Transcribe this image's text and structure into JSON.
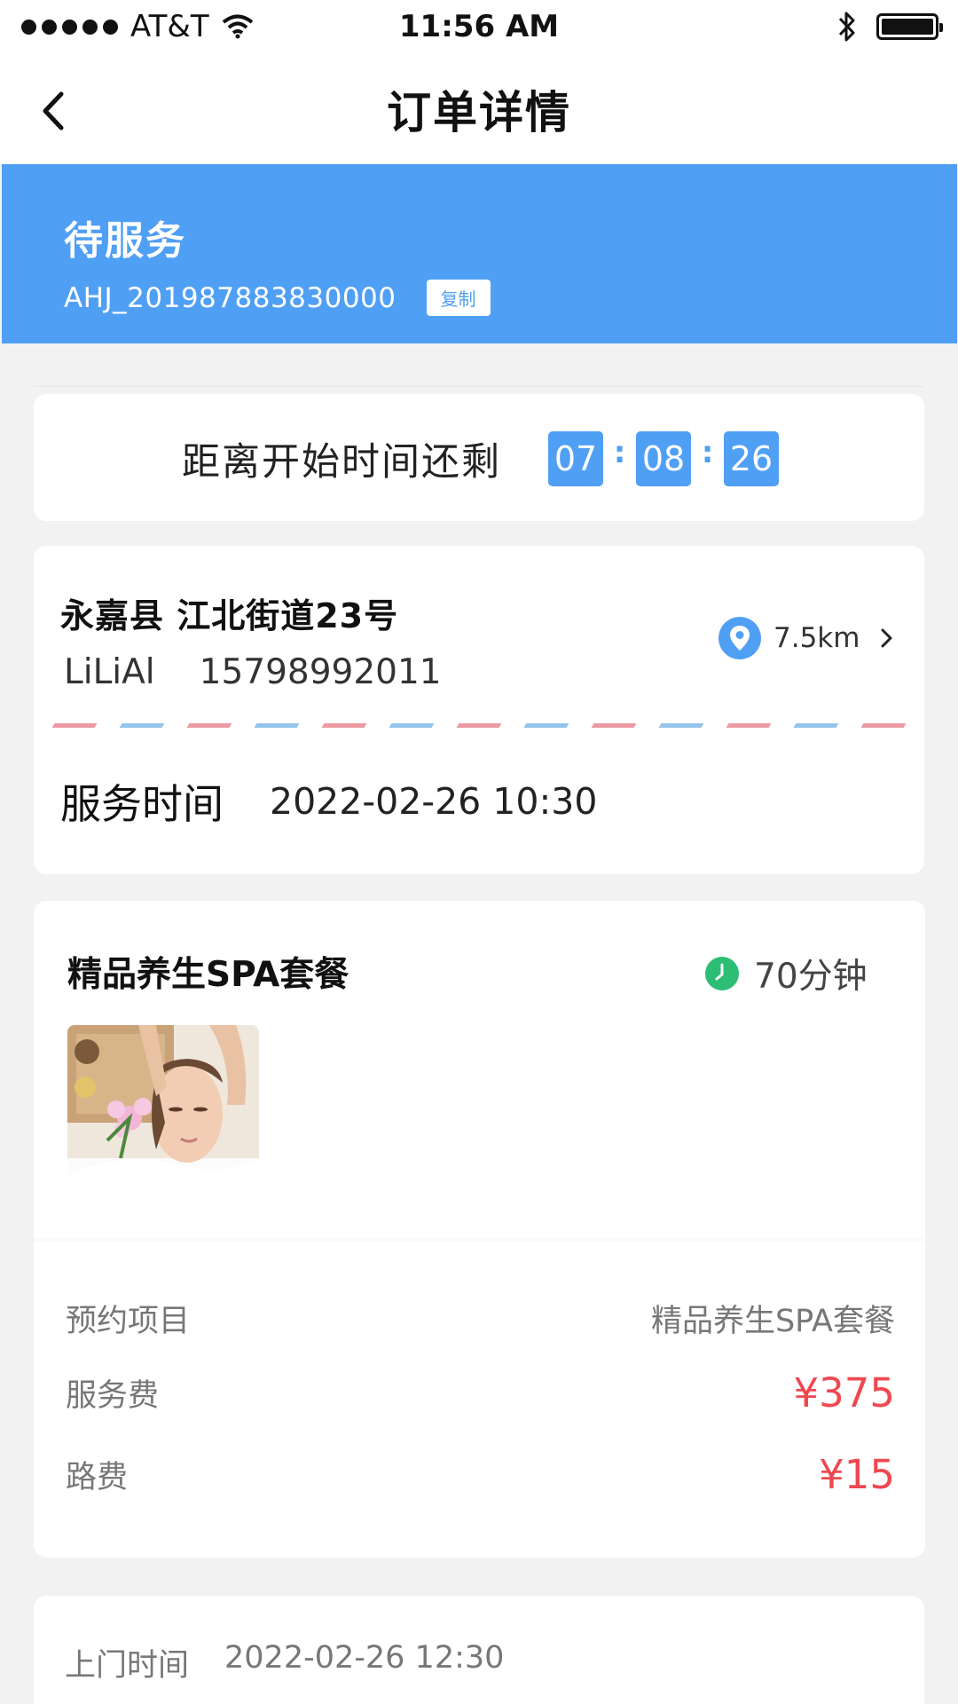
{
  "status_bar": {
    "carrier": "AT&T",
    "time": "11:56 AM"
  },
  "nav": {
    "title": "订单详情"
  },
  "order": {
    "status": "待服务",
    "number": "AHJ_201987883830000",
    "copy_label": "复制"
  },
  "countdown": {
    "label": "距离开始时间还剩",
    "hours": "07",
    "minutes": "08",
    "seconds": "26"
  },
  "address": {
    "location": "永嘉县 江北街道23号",
    "contact_name": "LiLiAl",
    "contact_phone": "15798992011",
    "distance": "7.5km"
  },
  "service_time": {
    "label": "服务时间",
    "value": "2022-02-26 10:30"
  },
  "package": {
    "name": "精品养生SPA套餐",
    "duration": "70分钟",
    "thumb_icon": "spa-photo"
  },
  "details": [
    {
      "label": "预约项目",
      "value": "精品养生SPA套餐"
    },
    {
      "label": "服务费",
      "value": "¥375"
    },
    {
      "label": "路费",
      "value": "¥15"
    }
  ],
  "visit": {
    "label": "上门时间",
    "value": "2022-02-26 12:30"
  },
  "colors": {
    "accent": "#4f9ff5",
    "price": "#ef4851",
    "clock": "#2dbd75",
    "stripe_red": "#ec9aa2",
    "stripe_blue": "#94c4ea"
  }
}
